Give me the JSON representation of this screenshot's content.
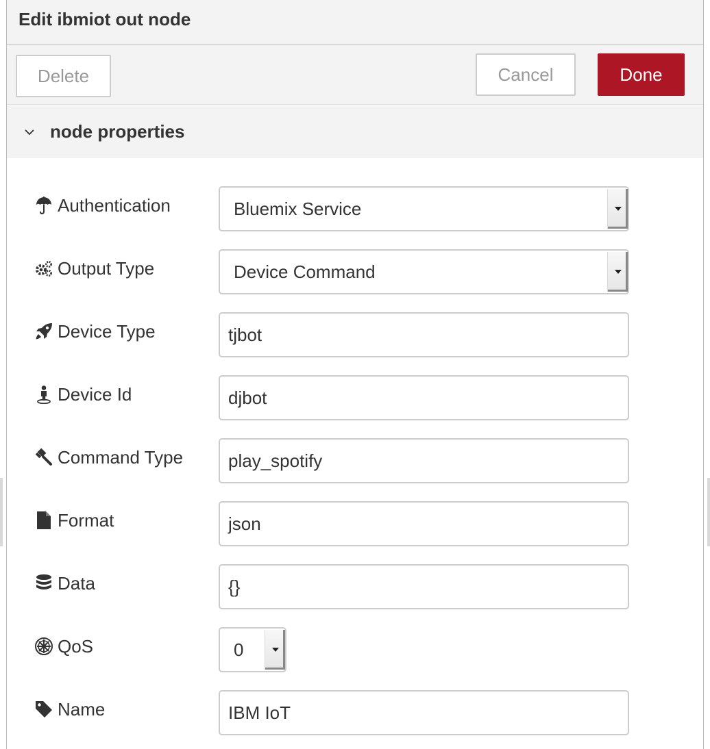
{
  "dialog": {
    "title": "Edit ibmiot out node",
    "delete_label": "Delete",
    "cancel_label": "Cancel",
    "done_label": "Done",
    "accent_color": "#ad1625"
  },
  "section": {
    "title": "node properties",
    "icon": "chevron-down-icon"
  },
  "fields": {
    "authentication": {
      "label": "Authentication",
      "icon": "umbrella-icon",
      "value": "Bluemix Service"
    },
    "output_type": {
      "label": "Output Type",
      "icon": "gears-icon",
      "value": "Device Command"
    },
    "device_type": {
      "label": "Device Type",
      "icon": "rocket-icon",
      "value": "tjbot"
    },
    "device_id": {
      "label": "Device Id",
      "icon": "street-view-icon",
      "value": "djbot"
    },
    "command_type": {
      "label": "Command Type",
      "icon": "gavel-icon",
      "value": "play_spotify"
    },
    "format": {
      "label": "Format",
      "icon": "file-icon",
      "value": "json"
    },
    "data": {
      "label": "Data",
      "icon": "database-icon",
      "value": "{}"
    },
    "qos": {
      "label": "QoS",
      "icon": "empire-icon",
      "value": "0"
    },
    "name": {
      "label": "Name",
      "icon": "tag-icon",
      "value": "IBM IoT"
    }
  }
}
